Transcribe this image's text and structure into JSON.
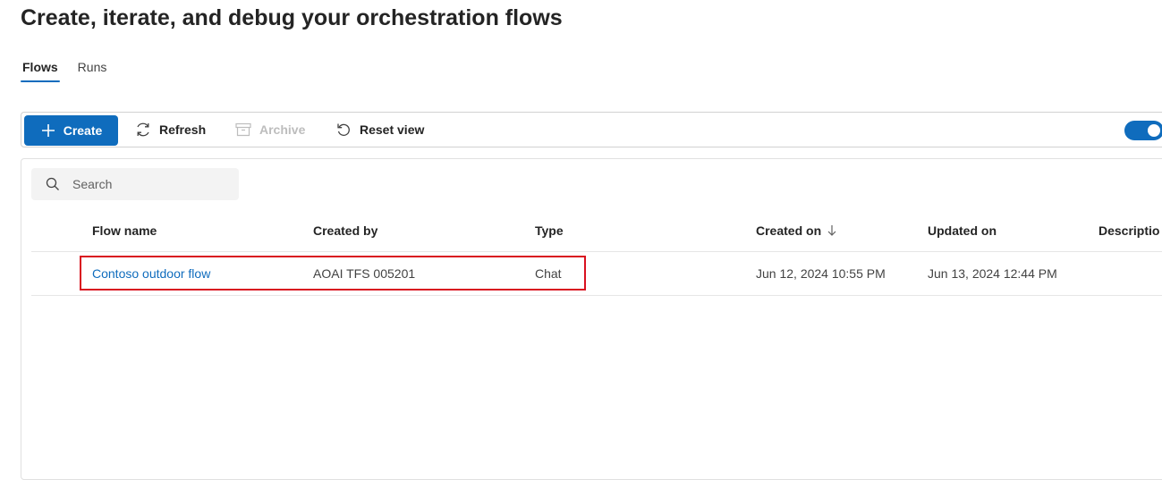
{
  "page": {
    "title": "Create, iterate, and debug your orchestration flows"
  },
  "tabs": [
    {
      "label": "Flows",
      "active": true
    },
    {
      "label": "Runs",
      "active": false
    }
  ],
  "toolbar": {
    "create_label": "Create",
    "refresh_label": "Refresh",
    "archive_label": "Archive",
    "reset_view_label": "Reset view",
    "toggle_on": true
  },
  "search": {
    "placeholder": "Search"
  },
  "table": {
    "columns": [
      "Flow name",
      "Created by",
      "Type",
      "Created on",
      "Updated on",
      "Descriptio"
    ],
    "sort_column": "Created on",
    "sort_direction": "descending",
    "rows": [
      {
        "flow_name": "Contoso outdoor flow",
        "created_by": "AOAI TFS 005201",
        "type": "Chat",
        "created_on": "Jun 12, 2024 10:55 PM",
        "updated_on": "Jun 13, 2024 12:44 PM",
        "description": ""
      }
    ]
  },
  "colors": {
    "accent": "#0f6cbd",
    "highlight": "#d9111f"
  }
}
